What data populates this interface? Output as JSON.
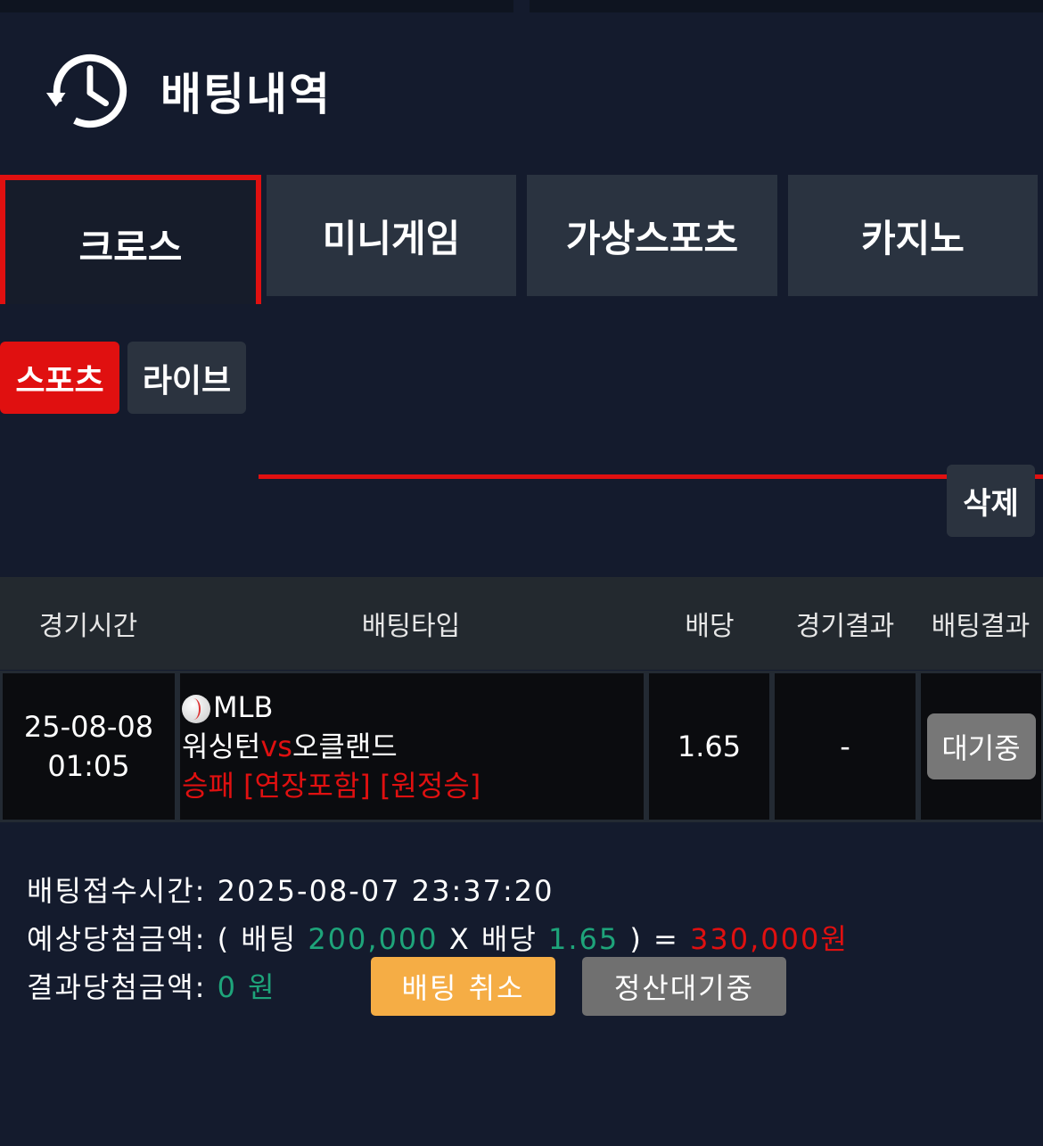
{
  "header": {
    "title": "배팅내역",
    "icon": "history-clock-icon"
  },
  "tabs": [
    {
      "label": "크로스",
      "active": true
    },
    {
      "label": "미니게임",
      "active": false
    },
    {
      "label": "가상스포츠",
      "active": false
    },
    {
      "label": "카지노",
      "active": false
    }
  ],
  "subtabs": [
    {
      "label": "스포츠",
      "active": true
    },
    {
      "label": "라이브",
      "active": false
    }
  ],
  "delete_label": "삭제",
  "table": {
    "headers": [
      "경기시간",
      "배팅타입",
      "배당",
      "경기결과",
      "배팅결과"
    ],
    "row": {
      "date": "25-08-08",
      "time": "01:05",
      "league": "MLB",
      "home": "워싱턴",
      "vs": "vs",
      "away": "오클랜드",
      "bet_type": "승패 [연장포함] [원정승]",
      "odds": "1.65",
      "game_result": "-",
      "bet_result": "대기중"
    }
  },
  "summary": {
    "received_label": "배팅접수시간:",
    "received_value": "2025-08-07 23:37:20",
    "expected_label": "예상당첨금액:",
    "open_paren": "(",
    "bet_word": "배팅",
    "bet_amount": "200,000",
    "times": "X",
    "odds_word": "배당",
    "odds_value": "1.65",
    "close_eq": ") =",
    "expected_value": "330,000원",
    "result_label": "결과당첨금액:",
    "result_value": "0 원"
  },
  "buttons": {
    "cancel": "배팅 취소",
    "settle": "정산대기중"
  },
  "colors": {
    "accent_red": "#e01010",
    "green": "#1ea47a",
    "orange": "#f5ad45",
    "background": "#141b2d"
  }
}
